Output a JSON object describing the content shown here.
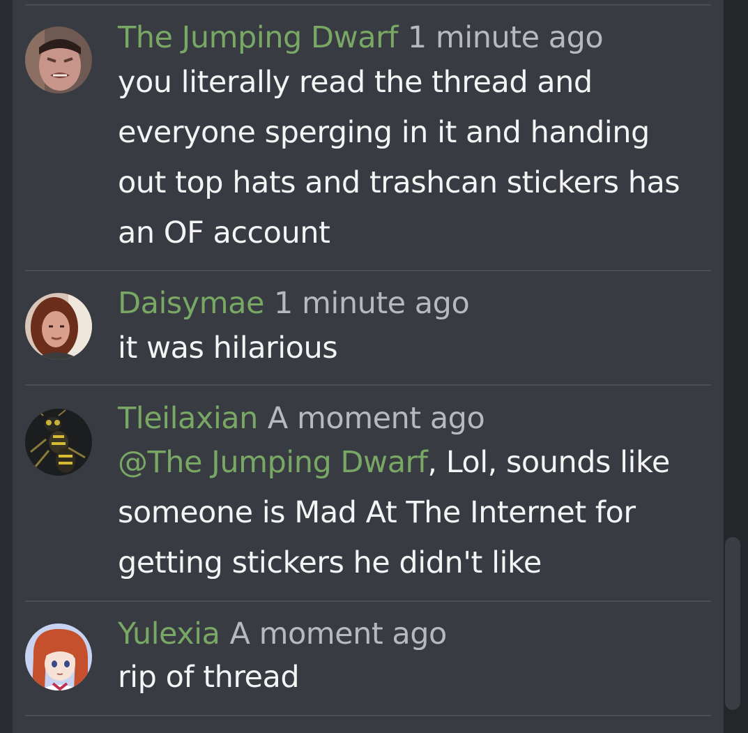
{
  "comments": [
    {
      "author": "The Jumping Dwarf",
      "time": "1 minute ago",
      "avatar_icon": "user-avatar-grimace",
      "text": "you literally read the thread and everyone sperging in it and handing out top hats and trashcan stickers has an OF account"
    },
    {
      "author": "Daisymae",
      "time": "1 minute ago",
      "avatar_icon": "user-avatar-portrait",
      "text": "it was hilarious"
    },
    {
      "author": "Tleilaxian",
      "time": "A moment ago",
      "avatar_icon": "user-avatar-wasp",
      "mention": "@The Jumping Dwarf",
      "text": ", Lol, sounds like someone is Mad At The Internet for getting stickers he didn't like"
    },
    {
      "author": "Yulexia",
      "time": "A moment ago",
      "avatar_icon": "user-avatar-anime",
      "text": "rip of thread"
    }
  ],
  "colors": {
    "author": "#78a864",
    "timestamp": "#b7b9bd",
    "text": "#f4f4f4",
    "panel": "#393b43",
    "background": "#2a2c31"
  }
}
